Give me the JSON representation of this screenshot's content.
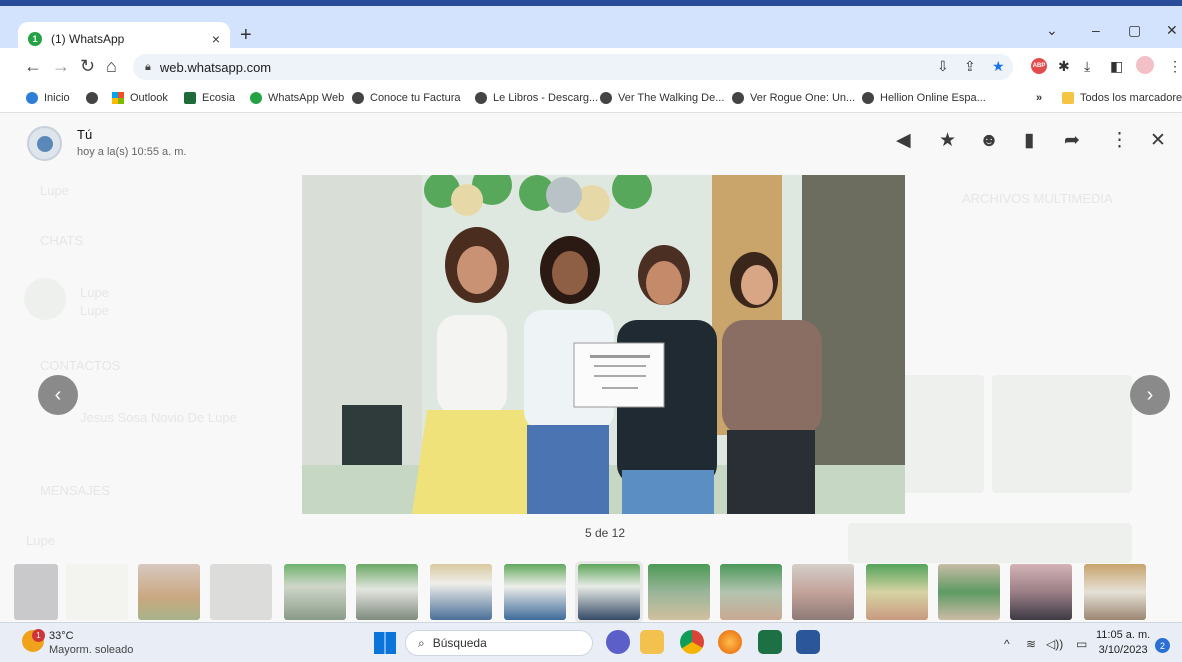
{
  "browser": {
    "tab_title": "(1) WhatsApp",
    "tab_badge": "1",
    "tab_close": "×",
    "new_tab": "+",
    "url": "web.whatsapp.com",
    "window_controls": {
      "minimize_chevron": "⌄",
      "minimize": "–",
      "maximize": "▢",
      "close": "✕"
    },
    "ext_abp": "ABP"
  },
  "bookmarks": [
    {
      "label": "Inicio",
      "icon": "chrome-icon"
    },
    {
      "label": "",
      "icon": "globe-icon"
    },
    {
      "label": "Outlook",
      "icon": "microsoft-icon"
    },
    {
      "label": "Ecosia",
      "icon": "ecosia-icon"
    },
    {
      "label": "WhatsApp Web",
      "icon": "whatsapp-icon"
    },
    {
      "label": "Conoce tu Factura",
      "icon": "globe-icon"
    },
    {
      "label": "Le Libros - Descarg...",
      "icon": "globe-icon"
    },
    {
      "label": "Ver The Walking De...",
      "icon": "globe-icon"
    },
    {
      "label": "Ver Rogue One: Un...",
      "icon": "globe-icon"
    },
    {
      "label": "Hellion Online Espa...",
      "icon": "globe-icon"
    }
  ],
  "bookmarks_more": "»",
  "bookmarks_all": "Todos los marcadores",
  "viewer": {
    "sender": "Tú",
    "time": "hoy a la(s) 10:55 a. m.",
    "counter": "5 de 12",
    "prev": "‹",
    "next": "›",
    "actions": {
      "reply": "◀",
      "star": "★",
      "react": "☻",
      "delete": "▮",
      "forward": "➦",
      "menu": "⋮",
      "close": "✕"
    }
  },
  "background_chat": {
    "search": "Lupe",
    "section_chats": "CHATS",
    "chat_name": "Lupe",
    "chat_sub": "Lupe",
    "section_contacts": "CONTACTOS",
    "contact_name": "Jesus Sosa Novio De Lupe",
    "section_messages": "MENSAJES",
    "message_from": "Lupe",
    "right_header": "ARCHIVOS MULTIMEDIA"
  },
  "taskbar": {
    "temp": "33°C",
    "condition": "Mayorm. soleado",
    "weather_badge": "1",
    "search": "Búsqueda",
    "time": "11:05 a. m.",
    "date": "3/10/2023",
    "notifications": "2",
    "tray_up": "^",
    "tray_wifi": "≋",
    "tray_sound": "◁))",
    "tray_battery": "▭"
  }
}
